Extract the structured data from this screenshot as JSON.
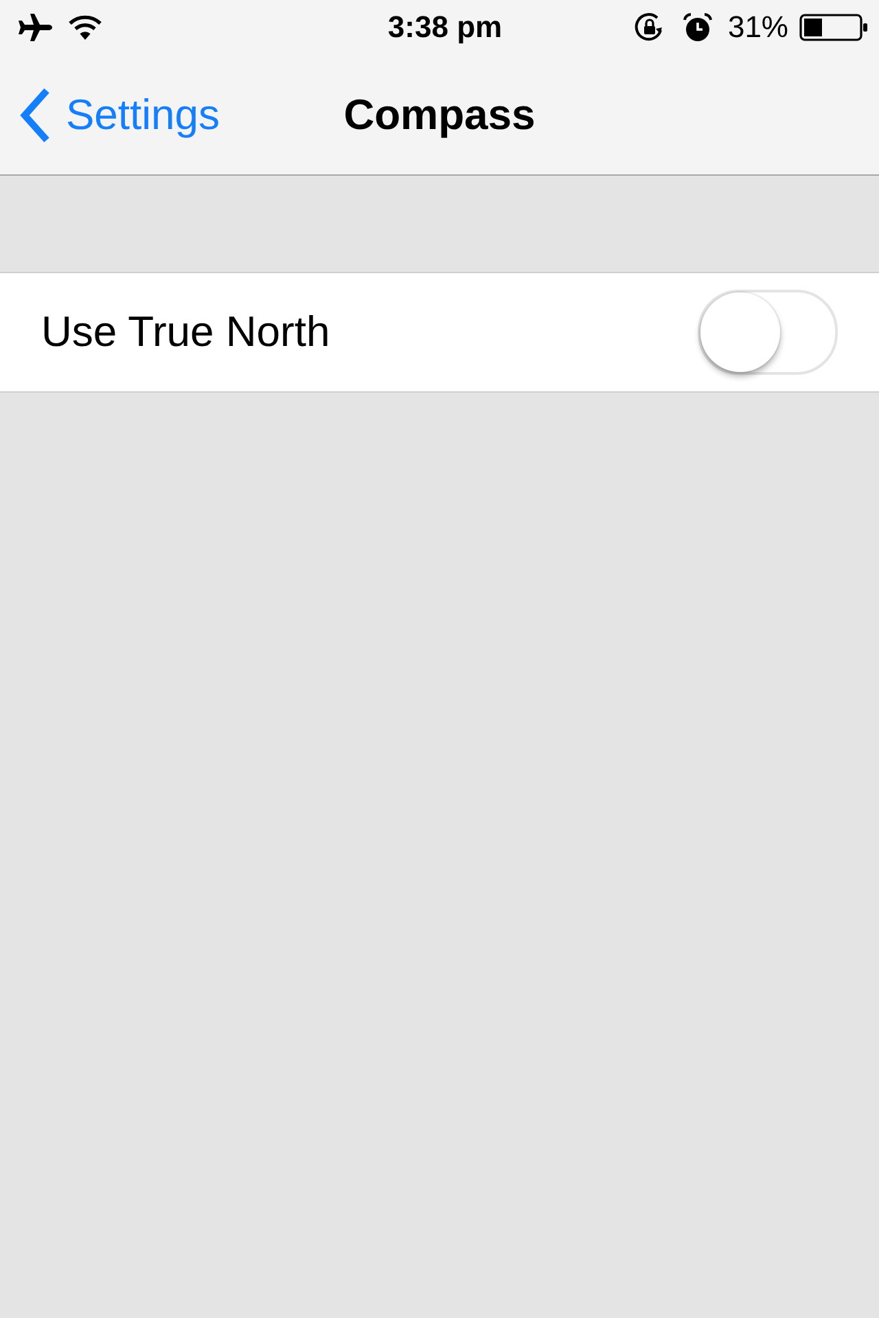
{
  "status_bar": {
    "time": "3:38 pm",
    "battery_percent": "31%"
  },
  "nav_bar": {
    "back_label": "Settings",
    "title": "Compass"
  },
  "settings": [
    {
      "kind": "toggle",
      "label": "Use True North",
      "on": false
    }
  ]
}
